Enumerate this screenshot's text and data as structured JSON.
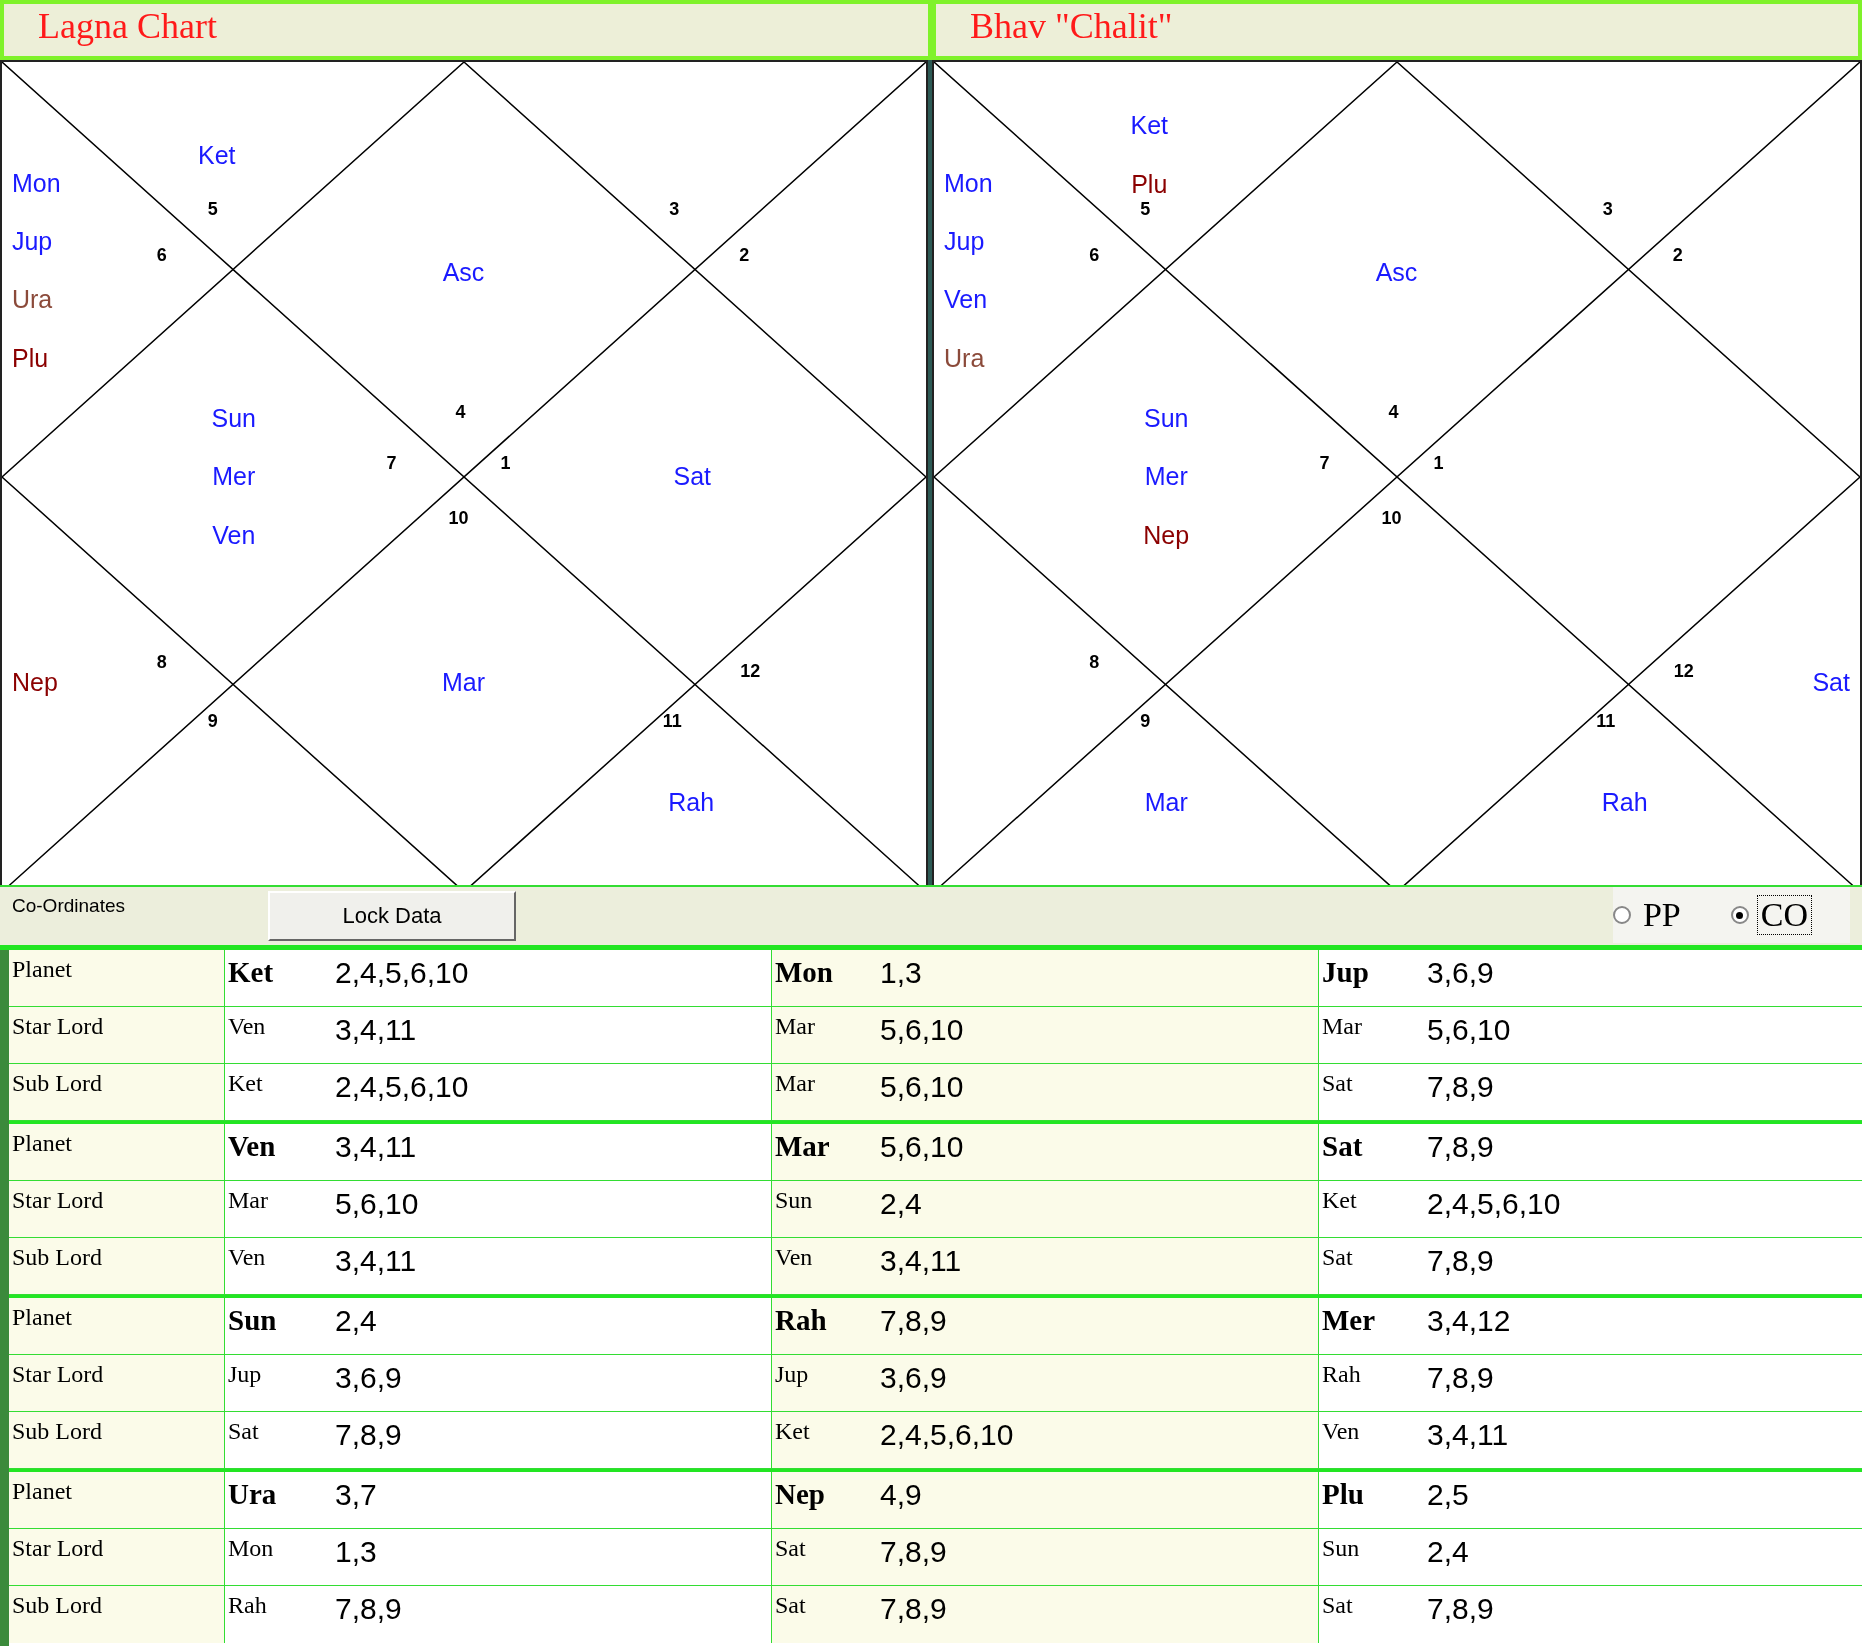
{
  "charts": [
    {
      "title": "Lagna Chart",
      "houses": [
        {
          "number": "4",
          "planets": [
            {
              "name": "Asc",
              "color": "#1a1aff"
            }
          ]
        },
        {
          "number": "5",
          "planets": [
            {
              "name": "Ket",
              "color": "#1a1aff"
            }
          ]
        },
        {
          "number": "6",
          "planets": [
            {
              "name": "Mon",
              "color": "#1a1aff"
            },
            {
              "name": "Jup",
              "color": "#1a1aff"
            },
            {
              "name": "Ura",
              "color": "#8b4a3a"
            },
            {
              "name": "Plu",
              "color": "#8b0000"
            }
          ]
        },
        {
          "number": "7",
          "planets": [
            {
              "name": "Sun",
              "color": "#1a1aff"
            },
            {
              "name": "Mer",
              "color": "#1a1aff"
            },
            {
              "name": "Ven",
              "color": "#1a1aff"
            }
          ]
        },
        {
          "number": "8",
          "planets": [
            {
              "name": "Nep",
              "color": "#8b0000"
            }
          ]
        },
        {
          "number": "9"
        },
        {
          "number": "10",
          "planets": [
            {
              "name": "Mar",
              "color": "#1a1aff"
            }
          ]
        },
        {
          "number": "11",
          "planets": [
            {
              "name": "Rah",
              "color": "#1a1aff"
            }
          ]
        },
        {
          "number": "12"
        },
        {
          "number": "1",
          "planets": [
            {
              "name": "Sat",
              "color": "#1a1aff"
            }
          ]
        },
        {
          "number": "2"
        },
        {
          "number": "3"
        }
      ]
    },
    {
      "title": "Bhav \"Chalit\"",
      "houses": [
        {
          "number": "4",
          "planets": [
            {
              "name": "Asc",
              "color": "#1a1aff"
            }
          ]
        },
        {
          "number": "5",
          "planets": [
            {
              "name": "Ket",
              "color": "#1a1aff"
            },
            {
              "name": "Plu",
              "color": "#8b0000"
            }
          ]
        },
        {
          "number": "6",
          "planets": [
            {
              "name": "Mon",
              "color": "#1a1aff"
            },
            {
              "name": "Jup",
              "color": "#1a1aff"
            },
            {
              "name": "Ven",
              "color": "#1a1aff"
            },
            {
              "name": "Ura",
              "color": "#8b4a3a"
            }
          ]
        },
        {
          "number": "7",
          "planets": [
            {
              "name": "Sun",
              "color": "#1a1aff"
            },
            {
              "name": "Mer",
              "color": "#1a1aff"
            },
            {
              "name": "Nep",
              "color": "#8b0000"
            }
          ]
        },
        {
          "number": "8"
        },
        {
          "number": "9",
          "planets": [
            {
              "name": "Mar",
              "color": "#1a1aff"
            }
          ]
        },
        {
          "number": "10"
        },
        {
          "number": "11",
          "planets": [
            {
              "name": "Rah",
              "color": "#1a1aff"
            }
          ]
        },
        {
          "number": "12",
          "planets": [
            {
              "name": "Sat",
              "color": "#1a1aff"
            }
          ]
        },
        {
          "number": "1"
        },
        {
          "number": "2"
        },
        {
          "number": "3"
        }
      ]
    }
  ],
  "controls": {
    "label": "Co-Ordinates",
    "button": "Lock Data",
    "options": [
      {
        "label": "PP",
        "selected": false
      },
      {
        "label": "CO",
        "selected": true
      }
    ]
  },
  "table": {
    "groups": [
      {
        "rows": [
          {
            "kind": "planet",
            "label": "Planet",
            "cells": [
              {
                "name": "Ket",
                "value": "2,4,5,6,10"
              },
              {
                "name": "Mon",
                "value": "1,3"
              },
              {
                "name": "Jup",
                "value": "3,6,9"
              }
            ]
          },
          {
            "kind": "lord",
            "label": "Star Lord",
            "cells": [
              {
                "name": "Ven",
                "value": "3,4,11"
              },
              {
                "name": "Mar",
                "value": "5,6,10"
              },
              {
                "name": "Mar",
                "value": "5,6,10"
              }
            ]
          },
          {
            "kind": "lord",
            "label": "Sub Lord",
            "cells": [
              {
                "name": "Ket",
                "value": "2,4,5,6,10"
              },
              {
                "name": "Mar",
                "value": "5,6,10"
              },
              {
                "name": "Sat",
                "value": "7,8,9"
              }
            ]
          }
        ]
      },
      {
        "rows": [
          {
            "kind": "planet",
            "label": "Planet",
            "cells": [
              {
                "name": "Ven",
                "value": "3,4,11"
              },
              {
                "name": "Mar",
                "value": "5,6,10"
              },
              {
                "name": "Sat",
                "value": "7,8,9"
              }
            ]
          },
          {
            "kind": "lord",
            "label": "Star Lord",
            "cells": [
              {
                "name": "Mar",
                "value": "5,6,10"
              },
              {
                "name": "Sun",
                "value": "2,4"
              },
              {
                "name": "Ket",
                "value": "2,4,5,6,10"
              }
            ]
          },
          {
            "kind": "lord",
            "label": "Sub Lord",
            "cells": [
              {
                "name": "Ven",
                "value": "3,4,11"
              },
              {
                "name": "Ven",
                "value": "3,4,11"
              },
              {
                "name": "Sat",
                "value": "7,8,9"
              }
            ]
          }
        ]
      },
      {
        "rows": [
          {
            "kind": "planet",
            "label": "Planet",
            "cells": [
              {
                "name": "Sun",
                "value": "2,4"
              },
              {
                "name": "Rah",
                "value": "7,8,9"
              },
              {
                "name": "Mer",
                "value": "3,4,12"
              }
            ]
          },
          {
            "kind": "lord",
            "label": "Star Lord",
            "cells": [
              {
                "name": "Jup",
                "value": "3,6,9"
              },
              {
                "name": "Jup",
                "value": "3,6,9"
              },
              {
                "name": "Rah",
                "value": "7,8,9"
              }
            ]
          },
          {
            "kind": "lord",
            "label": "Sub Lord",
            "cells": [
              {
                "name": "Sat",
                "value": "7,8,9"
              },
              {
                "name": "Ket",
                "value": "2,4,5,6,10"
              },
              {
                "name": "Ven",
                "value": "3,4,11"
              }
            ]
          }
        ]
      },
      {
        "rows": [
          {
            "kind": "planet",
            "label": "Planet",
            "cells": [
              {
                "name": "Ura",
                "value": "3,7"
              },
              {
                "name": "Nep",
                "value": "4,9"
              },
              {
                "name": "Plu",
                "value": "2,5"
              }
            ]
          },
          {
            "kind": "lord",
            "label": "Star Lord",
            "cells": [
              {
                "name": "Mon",
                "value": "1,3"
              },
              {
                "name": "Sat",
                "value": "7,8,9"
              },
              {
                "name": "Sun",
                "value": "2,4"
              }
            ]
          },
          {
            "kind": "lord",
            "label": "Sub Lord",
            "cells": [
              {
                "name": "Rah",
                "value": "7,8,9"
              },
              {
                "name": "Sat",
                "value": "7,8,9"
              },
              {
                "name": "Sat",
                "value": "7,8,9"
              }
            ]
          }
        ]
      }
    ]
  }
}
